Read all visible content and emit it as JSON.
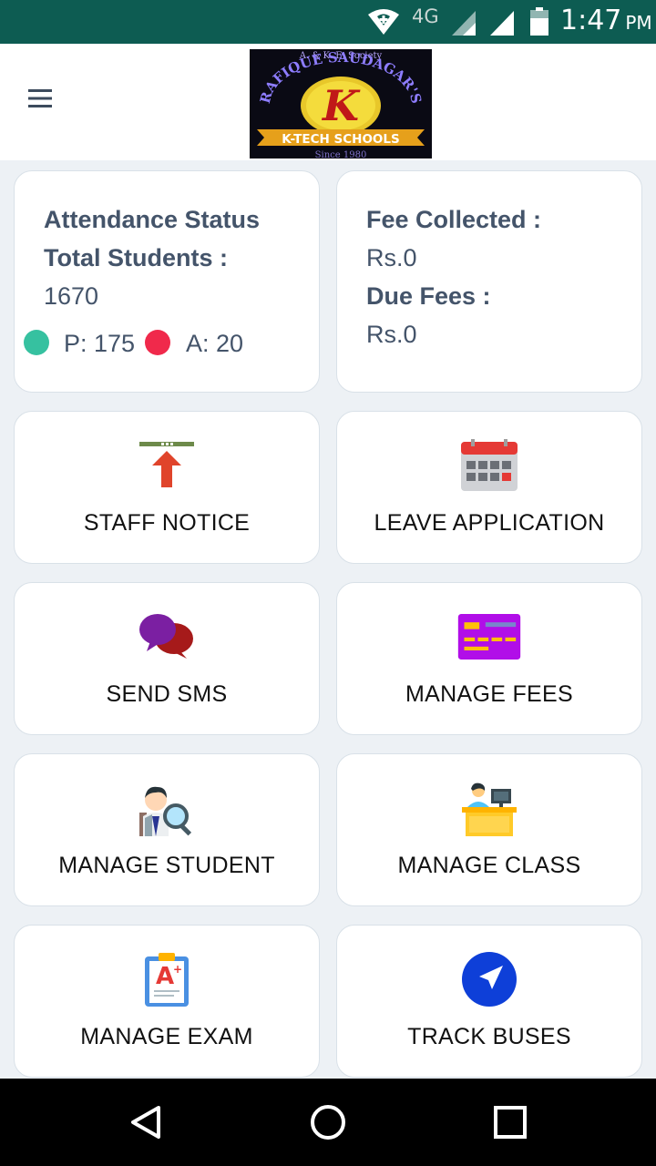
{
  "status_bar": {
    "network": "4G",
    "time": "1:47",
    "ampm": "PM",
    "icons": [
      "data-saver-icon",
      "signal-icon",
      "signal-icon",
      "battery-icon"
    ]
  },
  "header": {
    "menu_icon": "hamburger-menu-icon",
    "logo": {
      "society": "A. & K. E. Society",
      "arc_text": "RAFIQUE SAUDAGAR'S",
      "letter": "K",
      "banner": "K-TECH SCHOOLS",
      "since": "Since 1980"
    }
  },
  "attendance": {
    "title": "Attendance Status",
    "total_label": "Total Students :",
    "total_value": "1670",
    "present": "P: 175",
    "absent": "A: 20",
    "present_color": "#36c1a0",
    "absent_color": "#f0294b"
  },
  "fees_summary": {
    "collected_label": "Fee Collected :",
    "collected_value": "Rs.0",
    "due_label": "Due Fees :",
    "due_value": "Rs.0"
  },
  "tiles": [
    {
      "label": "STAFF NOTICE",
      "icon": "upload-notice-icon"
    },
    {
      "label": "LEAVE APPLICATION",
      "icon": "calendar-icon"
    },
    {
      "label": "SEND SMS",
      "icon": "chat-bubbles-icon"
    },
    {
      "label": "MANAGE FEES",
      "icon": "payment-card-icon"
    },
    {
      "label": "MANAGE STUDENT",
      "icon": "student-search-icon"
    },
    {
      "label": "MANAGE CLASS",
      "icon": "classroom-desk-icon"
    },
    {
      "label": "MANAGE EXAM",
      "icon": "exam-clipboard-icon"
    },
    {
      "label": "TRACK BUSES",
      "icon": "navigation-icon"
    }
  ],
  "nav": {
    "back": "back-icon",
    "home": "home-icon",
    "recents": "recents-icon"
  }
}
